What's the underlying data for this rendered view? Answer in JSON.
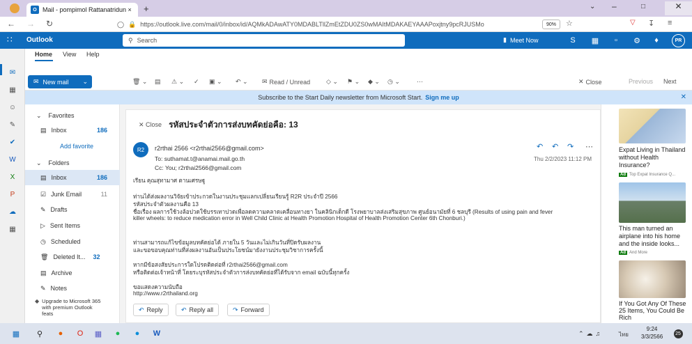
{
  "browser": {
    "tab_title": "Mail - pompimol Rattanatridun ×",
    "url": "https://outlook.live.com/mail/0/inbox/id/AQMkADAwATY0MDABLTllZmEtZDU0ZS0wMAItMDAKAEYAAAPoxjtny9pcRJUSMo",
    "zoom": "90%"
  },
  "outlook": {
    "app_name": "Outlook",
    "search_placeholder": "Search",
    "meet_now": "Meet Now",
    "avatar": "PR"
  },
  "ribbon": {
    "tabs": [
      "Home",
      "View",
      "Help"
    ],
    "new_mail": "New mail",
    "read_unread": "Read / Unread",
    "close": "Close",
    "previous": "Previous",
    "next": "Next"
  },
  "banner": {
    "text": "Subscribe to the Start Daily newsletter from Microsoft Start.",
    "link": "Sign me up"
  },
  "folders": {
    "favorites": "Favorites",
    "fav_inbox": "Inbox",
    "fav_inbox_count": "186",
    "add_favorite": "Add favorite",
    "folders": "Folders",
    "items": [
      {
        "label": "Inbox",
        "count": "186"
      },
      {
        "label": "Junk Email",
        "count": "11"
      },
      {
        "label": "Drafts",
        "count": ""
      },
      {
        "label": "Sent Items",
        "count": ""
      },
      {
        "label": "Scheduled",
        "count": ""
      },
      {
        "label": "Deleted It...",
        "count": "32"
      },
      {
        "label": "Archive",
        "count": ""
      },
      {
        "label": "Notes",
        "count": ""
      }
    ],
    "upgrade": "Upgrade to Microsoft 365 with premium Outlook feats"
  },
  "email": {
    "close": "Close",
    "subject": "รหัสประจำตัวการส่งบทคัดย่อคือ: 13",
    "avatar": "R2",
    "from": "r2rthai 2566 <r2rthai2566@gmail.com>",
    "to": "To:  suthamat.t@anamai.mail.go.th",
    "cc": "Cc:  You;  r2rthai2566@gmail.com",
    "date": "Thu 2/2/2023 11:12 PM",
    "body": [
      "เรียน คุณสุทามาศ ตานเศรษฐู",
      "ท่านได้ส่งผลงานวิจัยเข้าประกวดในงานประชุมแลกเปลี่ยนเรียนรู้ R2R ประจำปี 2566",
      "รหัสประจำตัวผลงานคือ 13",
      "ชื่อเรื่อง ผลการใช้วงล้อปวดใช้บรรเทาปวดเพื่อลดความคลาดเคลื่อนทางยา ในคลินิกเด็กดี โรงพยาบาลส่งเสริมสุขภาพ ศูนย์อนามัยที่ 6 ชลบุรี (Results of using pain and fever",
      "killer wheels: to reduce medication error in Well Child Clinic at Health Promotion Hospital of Health Promotion Center 6th Chonburi.)",
      "ท่านสามารถแก้ไขข้อมูลบทคัดย่อได้ ภายใน 5 วันและไม่เกินวันที่ปิดรับผลงาน",
      "และขอขอบคุณท่านที่ส่งผลงานอันเป็นประโยชน์มายังงานประชุมวิชาการครั้งนี้",
      "หากมีข้อสงสัยประการใดโปรดติดต่อที่ r2rthai2566@gmail.com",
      "หรือติดต่อเจ้าหน้าที่ โดยระบุรหัสประจำตัวการส่งบทคัดย่อที่ได้รับจาก email ฉบับนี้ทุกครั้ง",
      "ขอแสดงความนับถือ",
      "http://www.r2rthailand.org"
    ],
    "reply": "Reply",
    "reply_all": "Reply all",
    "forward": "Forward"
  },
  "ads": [
    {
      "title": "Expat Living in Thailand without Health Insurance?",
      "source": "Top Expat Insurance Q..."
    },
    {
      "title": "This man turned an airplane into his home and the inside looks...",
      "source": "And More"
    },
    {
      "title": "If You Got Any Of These 25 Items, You Could Be Rich",
      "source": ""
    }
  ],
  "ad_label": "Ad",
  "taskbar": {
    "time": "9:24",
    "date": "3/3/2566",
    "lang": "ไทย",
    "notif_count": "25"
  },
  "colors": {
    "accent": "#0f6cbd",
    "banner": "#cfe4fa",
    "taskbar": "#dde3ee"
  }
}
